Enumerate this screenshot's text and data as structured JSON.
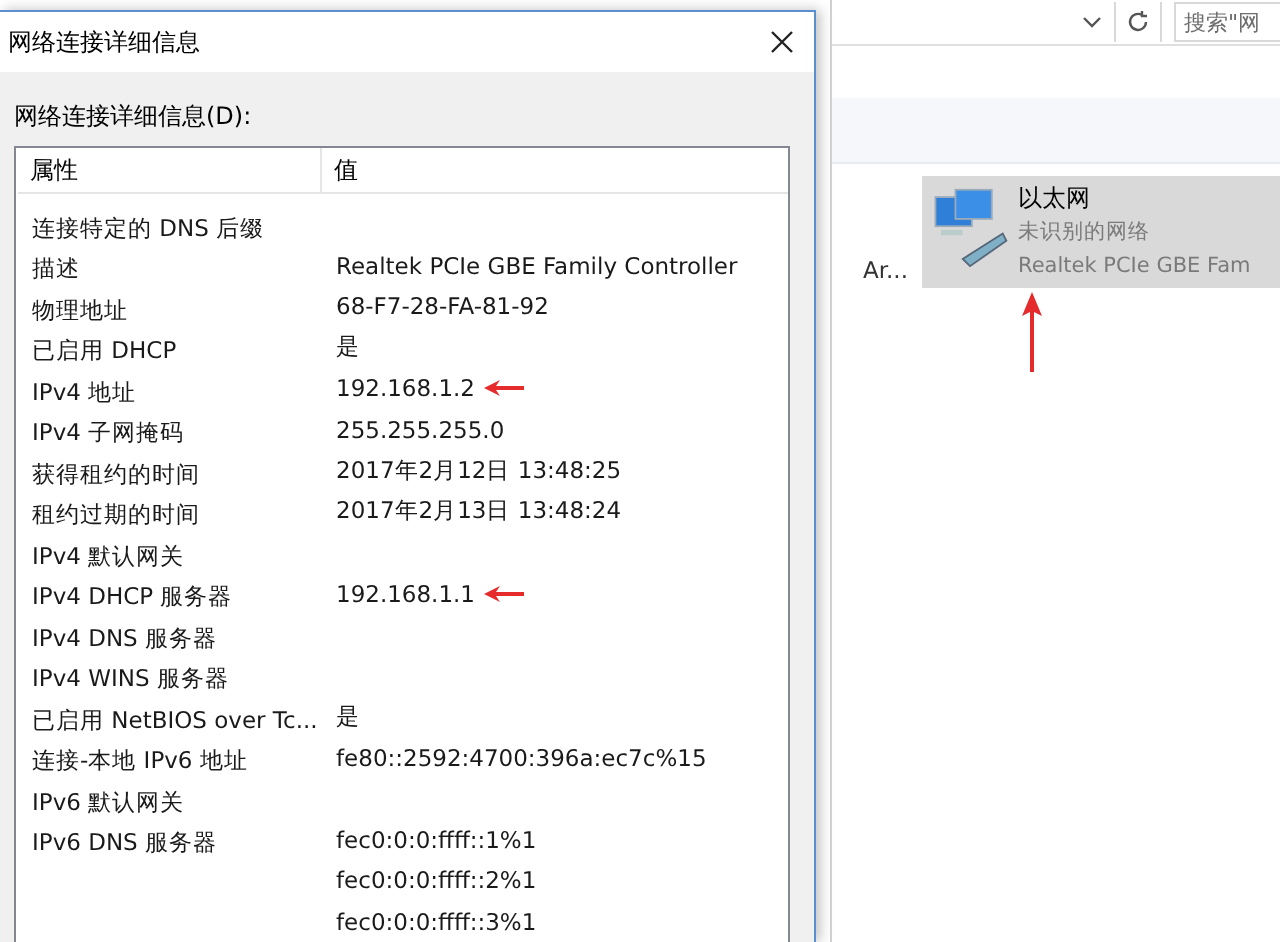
{
  "dialog": {
    "title": "网络连接详细信息",
    "label": "网络连接详细信息(D):",
    "columns": [
      "属性",
      "值"
    ],
    "rows": [
      {
        "property": "连接特定的 DNS 后缀",
        "marked": false
      },
      {
        "property": "描述",
        "value": "Realtek PCIe GBE Family Controller",
        "marked": false
      },
      {
        "property": "物理地址",
        "value": "68-F7-28-FA-81-92",
        "marked": false
      },
      {
        "property": "已启用 DHCP",
        "value": "是",
        "marked": false
      },
      {
        "property": "IPv4 地址",
        "value": "192.168.1.2",
        "marked": true
      },
      {
        "property": "IPv4 子网掩码",
        "value": "255.255.255.0",
        "marked": false
      },
      {
        "property": "获得租约的时间",
        "value": "2017年2月12日 13:48:25",
        "marked": false
      },
      {
        "property": "租约过期的时间",
        "value": "2017年2月13日 13:48:24",
        "marked": false
      },
      {
        "property": "IPv4 默认网关",
        "marked": false
      },
      {
        "property": "IPv4 DHCP 服务器",
        "value": "192.168.1.1",
        "marked": true
      },
      {
        "property": "IPv4 DNS 服务器",
        "marked": false
      },
      {
        "property": "IPv4 WINS 服务器",
        "marked": false
      },
      {
        "property": "已启用 NetBIOS over Tc...",
        "value": "是",
        "marked": false
      },
      {
        "property": "连接-本地 IPv6 地址",
        "value": "fe80::2592:4700:396a:ec7c%15",
        "marked": false
      },
      {
        "property": "IPv6 默认网关",
        "marked": false
      },
      {
        "property": "IPv6 DNS 服务器",
        "value": "fec0:0:0:ffff::1%1",
        "marked": false
      },
      {
        "value": "fec0:0:0:ffff::2%1",
        "marked": false
      },
      {
        "value": "fec0:0:0:ffff::3%1",
        "marked": false
      }
    ]
  },
  "explorer": {
    "search": {
      "placeholder": "搜索\"网"
    },
    "truncated_item": "Ar...",
    "adapter": {
      "name": "以太网",
      "status": "未识别的网络",
      "device": "Realtek PCIe GBE Fam",
      "selected": true,
      "marked": true
    }
  }
}
